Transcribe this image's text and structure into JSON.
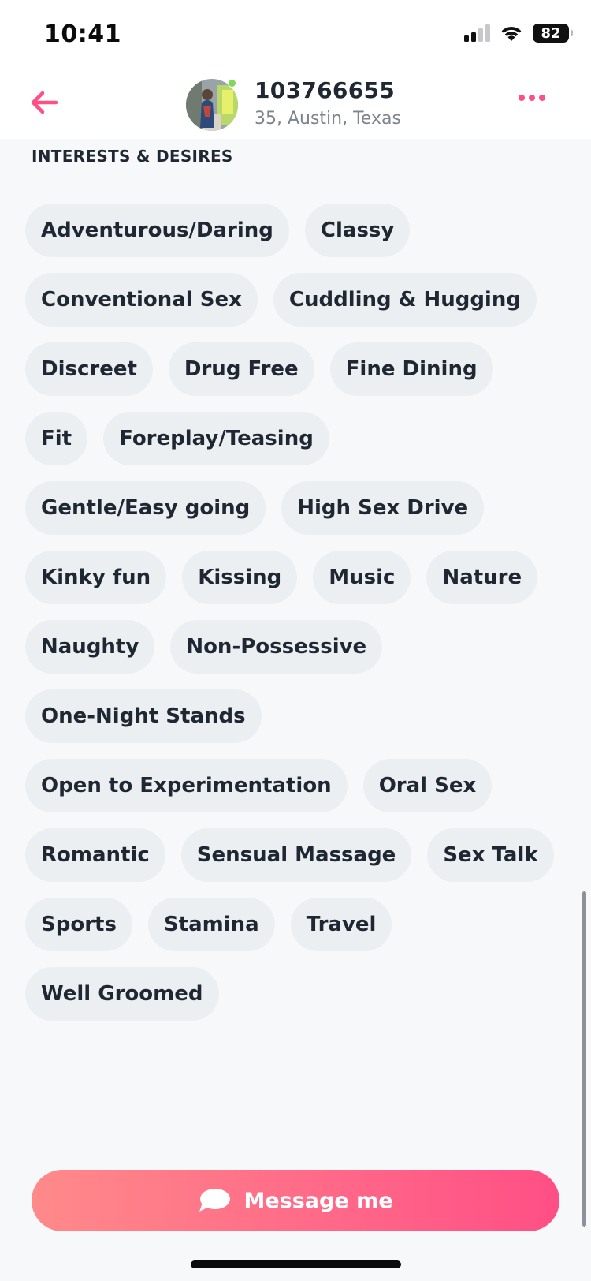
{
  "status_bar": {
    "time": "10:41",
    "battery": "82",
    "icons": [
      "cellular-signal-icon",
      "wifi-icon",
      "battery-icon"
    ]
  },
  "header": {
    "back_icon": "arrow-left-icon",
    "profile_name": "103766655",
    "profile_meta": "35, Austin, Texas",
    "online": true,
    "more_icon": "more-dots-icon"
  },
  "section": {
    "title": "INTERESTS & DESIRES",
    "chips": [
      "Adventurous/Daring",
      "Classy",
      "Conventional Sex",
      "Cuddling & Hugging",
      "Discreet",
      "Drug Free",
      "Fine Dining",
      "Fit",
      "Foreplay/Teasing",
      "Gentle/Easy going",
      "High Sex Drive",
      "Kinky fun",
      "Kissing",
      "Music",
      "Nature",
      "Naughty",
      "Non-Possessive",
      "One-Night Stands",
      "Open to Experimentation",
      "Oral Sex",
      "Romantic",
      "Sensual Massage",
      "Sex Talk",
      "Sports",
      "Stamina",
      "Travel",
      "Well Groomed"
    ]
  },
  "message_button": {
    "label": "Message me",
    "icon": "chat-bubble-icon"
  },
  "colors": {
    "accent": "#ff4f86",
    "gradient_start": "#ff8a8a",
    "gradient_end": "#ff4f86",
    "chip_bg": "#eceff2",
    "page_bg": "#f7f8fa",
    "text": "#1f2733",
    "muted": "#7e848d",
    "online": "#7ed957"
  }
}
